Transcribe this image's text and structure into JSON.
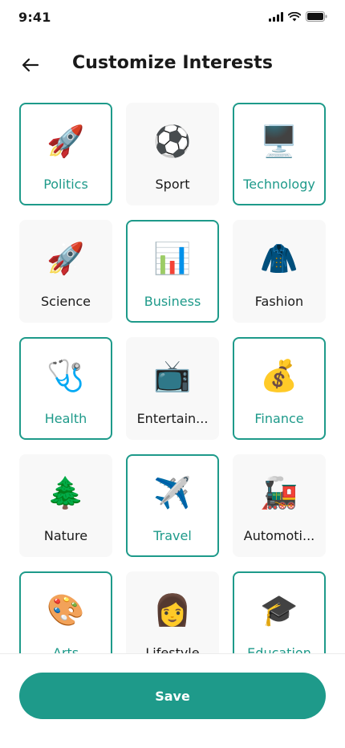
{
  "status_bar": {
    "time": "9:41"
  },
  "header": {
    "title": "Customize Interests",
    "back_icon": "arrow-left-icon"
  },
  "accent_color": "#1e9a8a",
  "interests": [
    {
      "label": "Politics",
      "icon": "🚀",
      "selected": true
    },
    {
      "label": "Sport",
      "icon": "⚽",
      "selected": false
    },
    {
      "label": "Technology",
      "icon": "🖥️",
      "selected": true
    },
    {
      "label": "Science",
      "icon": "🚀",
      "selected": false
    },
    {
      "label": "Business",
      "icon": "📊",
      "selected": true
    },
    {
      "label": "Fashion",
      "icon": "🧥",
      "selected": false
    },
    {
      "label": "Health",
      "icon": "🩺",
      "selected": true
    },
    {
      "label": "Entertain...",
      "icon": "📺",
      "selected": false
    },
    {
      "label": "Finance",
      "icon": "💰",
      "selected": true
    },
    {
      "label": "Nature",
      "icon": "🌲",
      "selected": false
    },
    {
      "label": "Travel",
      "icon": "✈️",
      "selected": true
    },
    {
      "label": "Automoti...",
      "icon": "🚂",
      "selected": false
    },
    {
      "label": "Arts",
      "icon": "🎨",
      "selected": true
    },
    {
      "label": "Lifestyle",
      "icon": "👩",
      "selected": false
    },
    {
      "label": "Education",
      "icon": "🎓",
      "selected": true
    }
  ],
  "footer": {
    "save_label": "Save"
  }
}
